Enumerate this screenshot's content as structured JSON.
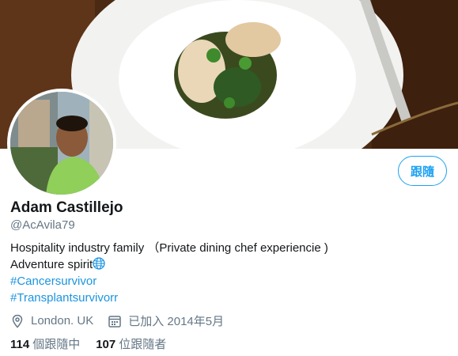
{
  "profile": {
    "name": "Adam Castillejo",
    "handle": "@AcAvila79",
    "follow_label": "跟隨",
    "bio_line1": "Hospitality industry family （Private dining chef experiencie )",
    "bio_line2": "Adventure spirit",
    "hashtag1": "#Cancersurvivor",
    "hashtag2": "#Transplantsurvivorr",
    "location": "London. UK",
    "joined": "已加入 2014年5月",
    "following_count": "114",
    "following_label": "個跟隨中",
    "followers_count": "107",
    "followers_label": "位跟隨者"
  },
  "icons": {
    "location": "location-pin-icon",
    "calendar": "calendar-icon",
    "globe": "globe-emoji-icon"
  },
  "colors": {
    "accent": "#1da1f2",
    "link": "#1b95e0",
    "secondary_text": "#657786",
    "primary_text": "#14171a"
  }
}
